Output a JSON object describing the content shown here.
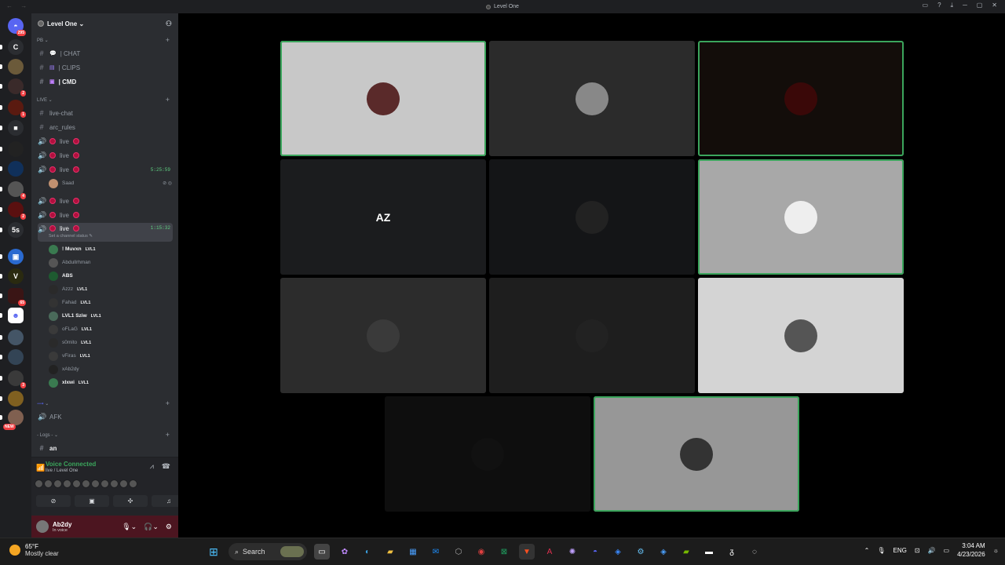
{
  "window": {
    "title": "Level One",
    "nav": "← →",
    "controls": [
      "▭",
      "?",
      "⤓",
      "─",
      "▢",
      "✕"
    ]
  },
  "guilds": [
    {
      "label": "◓",
      "color": "#5865f2",
      "badge": "295"
    },
    {
      "label": "C",
      "color": "#2b2d31",
      "badge": ""
    },
    {
      "label": "",
      "color": "#6b5a3a",
      "badge": ""
    },
    {
      "label": "",
      "color": "#3a2a2a",
      "badge": "2"
    },
    {
      "label": "",
      "color": "#5a1a10",
      "badge": "1"
    },
    {
      "label": "■",
      "color": "#2b2d31",
      "badge": ""
    },
    {
      "label": "",
      "color": "#222",
      "badge": ""
    },
    {
      "label": "",
      "color": "#10305a",
      "badge": ""
    },
    {
      "label": "",
      "color": "#555",
      "badge": "4"
    },
    {
      "label": "",
      "color": "#5a1010",
      "badge": "2"
    },
    {
      "label": "5s",
      "color": "#2b2d31",
      "badge": ""
    },
    {
      "label": "▣",
      "color": "#2a6ad0",
      "badge": ""
    },
    {
      "label": "V",
      "color": "#2a2a10",
      "badge": ""
    },
    {
      "label": "",
      "color": "#3a1515",
      "badge": "65"
    },
    {
      "label": "☻",
      "color": "#ffffff",
      "badge": ""
    },
    {
      "label": "",
      "color": "#445566",
      "badge": ""
    },
    {
      "label": "",
      "color": "#334455",
      "badge": ""
    },
    {
      "label": "",
      "color": "#3a3a3a",
      "badge": "3"
    },
    {
      "label": "",
      "color": "#806020",
      "badge": ""
    },
    {
      "label": "",
      "color": "#806050",
      "badge": "NEW"
    }
  ],
  "server": {
    "name": "Level One ⌄"
  },
  "categories": {
    "pb": "PB ⌄",
    "live": "LIVE ⌄",
    "blank": "⌄",
    "logs": "- Logs - ⌄"
  },
  "channels": {
    "chat": "| CHAT",
    "clips": "| CLIPS",
    "cmd": "| CMD",
    "livechat": "live-chat",
    "arcrules": "arc_rules",
    "live": "live",
    "afk": "AFK",
    "an": "an"
  },
  "timers": {
    "t1": "5:25:59",
    "t2": "1:15:32"
  },
  "saad": "Saad",
  "channel_status": "Set a channel status ✎",
  "voice_users": [
    {
      "name": "! Muvxn",
      "tag": "LVL1",
      "bold": true
    },
    {
      "name": "Abdullrhman",
      "tag": "",
      "bold": false
    },
    {
      "name": "ABS",
      "tag": "",
      "bold": true
    },
    {
      "name": "Azzz",
      "tag": "LVL1",
      "bold": false
    },
    {
      "name": "Fahad",
      "tag": "LVL1",
      "bold": false
    },
    {
      "name": "LVL1 Sziw",
      "tag": "LVL1",
      "bold": true
    },
    {
      "name": "oFLaG",
      "tag": "LVL1",
      "bold": false
    },
    {
      "name": "s0mito",
      "tag": "LVL1",
      "bold": false
    },
    {
      "name": "vFiras",
      "tag": "LVL1",
      "bold": false
    },
    {
      "name": "xAb2dy",
      "tag": "",
      "bold": false
    },
    {
      "name": "xlxwi",
      "tag": "LVL1",
      "bold": true
    }
  ],
  "voice_panel": {
    "status": "Voice Connected",
    "channel": "live / Level One"
  },
  "user": {
    "name": "Ab2dy",
    "status": "In voice"
  },
  "tiles": [
    {
      "bg": "#c8c8c8",
      "speaking": true,
      "avbg": "#5a2a2a",
      "txt": ""
    },
    {
      "bg": "#2b2b2b",
      "speaking": false,
      "avbg": "#888",
      "txt": ""
    },
    {
      "bg": "#130d0a",
      "speaking": true,
      "avbg": "#3a0808",
      "txt": ""
    },
    {
      "bg": "#1b1c1e",
      "speaking": false,
      "avbg": "transparent",
      "txt": "AZ"
    },
    {
      "bg": "#141517",
      "speaking": false,
      "avbg": "#222",
      "txt": ""
    },
    {
      "bg": "#a8a8a8",
      "speaking": true,
      "avbg": "#eee",
      "txt": ""
    },
    {
      "bg": "#2c2c2c",
      "speaking": false,
      "avbg": "#3a3a3a",
      "txt": ""
    },
    {
      "bg": "#1e1e1e",
      "speaking": false,
      "avbg": "#222",
      "txt": ""
    },
    {
      "bg": "#d4d4d4",
      "speaking": false,
      "avbg": "#555",
      "txt": ""
    },
    {
      "bg": "#0e0e0e",
      "speaking": false,
      "avbg": "#111",
      "txt": ""
    },
    {
      "bg": "#979797",
      "speaking": true,
      "avbg": "#333",
      "txt": ""
    }
  ],
  "taskbar": {
    "temp": "65°F",
    "weather": "Mostly clear",
    "search": "Search",
    "lang": "ENG",
    "time": "3:04 AM",
    "date": "4/23/2026"
  }
}
